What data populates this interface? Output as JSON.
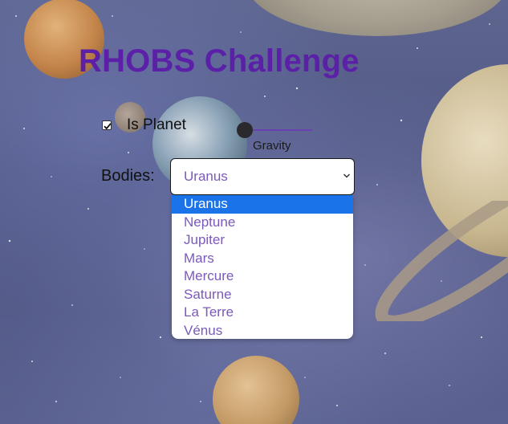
{
  "header": {
    "title": "RHOBS Challenge"
  },
  "filters": {
    "is_planet": {
      "label": "Is Planet",
      "checked": true
    },
    "gravity": {
      "label": "Gravity",
      "value_fraction": 0.0
    }
  },
  "bodies": {
    "label": "Bodies:",
    "selected": "Uranus",
    "options": [
      "Uranus",
      "Neptune",
      "Jupiter",
      "Mars",
      "Mercure",
      "Saturne",
      "La Terre",
      "Vénus"
    ],
    "open": true
  },
  "colors": {
    "title": "#5b1fa8",
    "accent": "#6a3fb0",
    "option_text": "#7b59b8",
    "highlight": "#1a73e8"
  },
  "icons": {
    "checkbox_mark": "check-icon",
    "select_arrow": "chevron-down-icon"
  }
}
